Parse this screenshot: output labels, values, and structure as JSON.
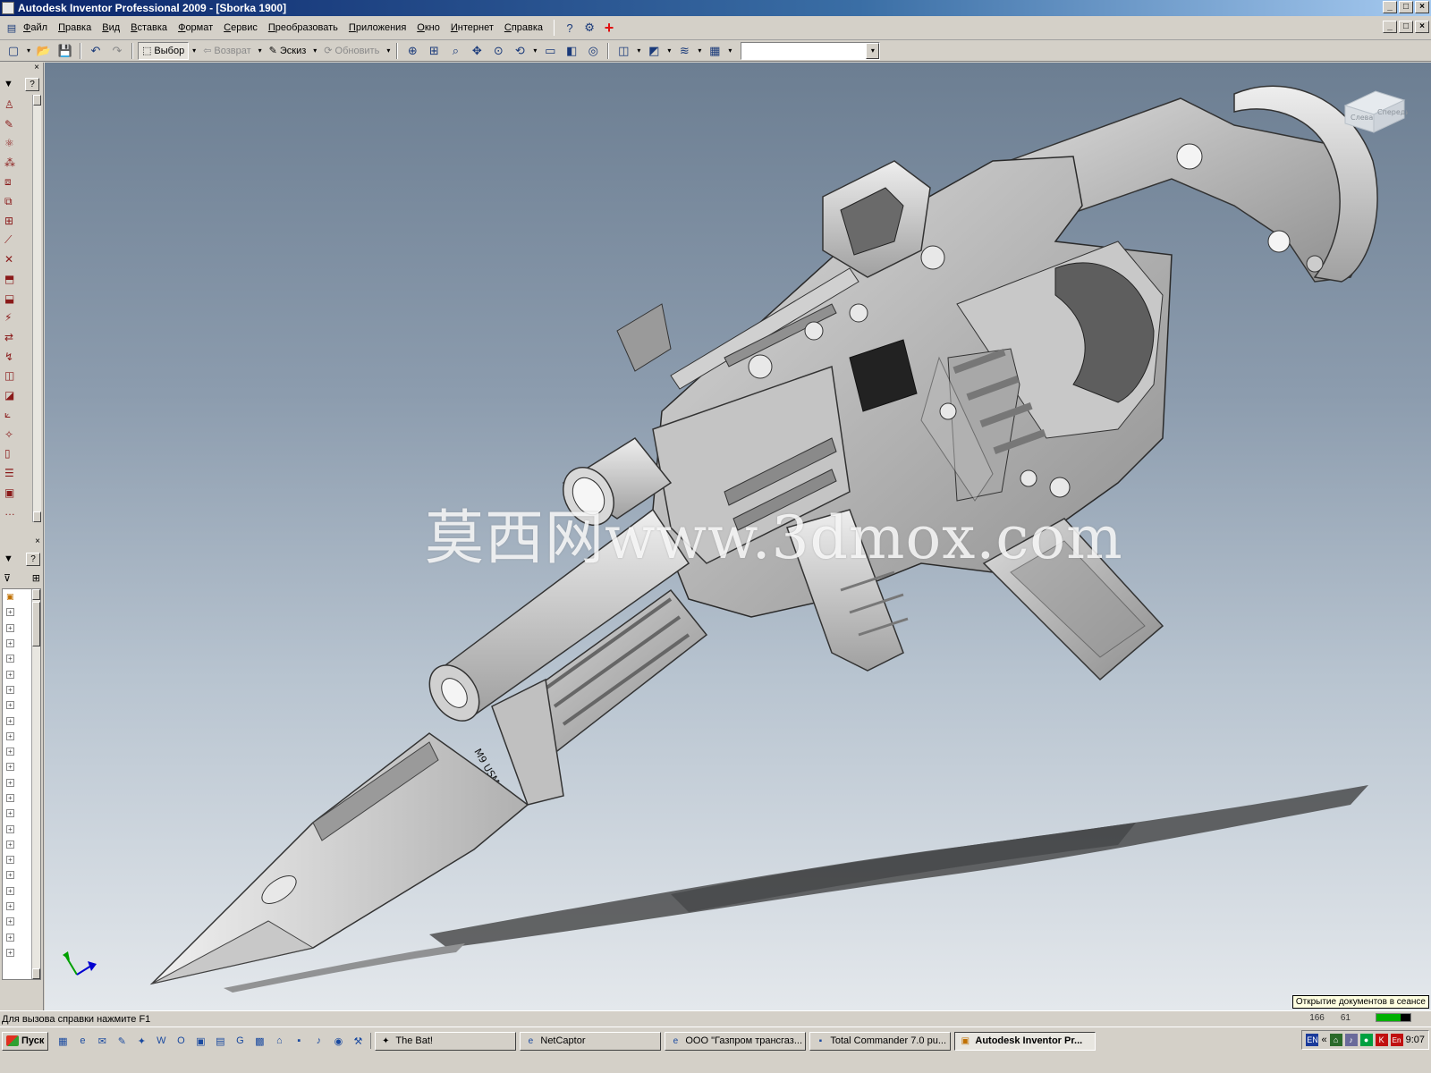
{
  "window": {
    "title": "Autodesk Inventor Professional 2009 - [Sborka 1900]",
    "controls": [
      "_",
      "□",
      "×"
    ]
  },
  "menu": {
    "items": [
      "Файл",
      "Правка",
      "Вид",
      "Вставка",
      "Формат",
      "Сервис",
      "Преобразовать",
      "Приложения",
      "Окно",
      "Интернет",
      "Справка"
    ]
  },
  "toolbar": {
    "select_label": "Выбор",
    "return_label": "Возврат",
    "sketch_label": "Эскиз",
    "update_label": "Обновить",
    "combo_value": ""
  },
  "viewport": {
    "watermark": "莫西网www.3dmox.com",
    "viewcube_faces": [
      "Слева",
      "Спереди"
    ],
    "model_markings": [
      "M9 USMC"
    ]
  },
  "statusbar": {
    "help_text": "Для вызова справки нажмите F1",
    "tooltip": "Открытие документов в сеансе",
    "count_a": "166",
    "count_b": "61"
  },
  "taskbar": {
    "start_label": "Пуск",
    "tasks": [
      {
        "label": "The Bat!",
        "icon": "bat-icon",
        "active": false
      },
      {
        "label": "NetCaptor",
        "icon": "netcaptor-icon",
        "active": false
      },
      {
        "label": "ООО \"Газпром трансгаз...",
        "icon": "ie-icon",
        "active": false
      },
      {
        "label": "Total Commander 7.0 pu...",
        "icon": "disk-icon",
        "active": false
      },
      {
        "label": "Autodesk Inventor Pr...",
        "icon": "inventor-icon",
        "active": true
      }
    ],
    "tray": {
      "lang": "EN",
      "lang2": "En",
      "clock": "9:07"
    }
  },
  "colors": {
    "titlebar_start": "#0a246a",
    "titlebar_end": "#a6caf0",
    "chrome": "#d4d0c8",
    "viewport_top": "#6c7e92",
    "viewport_bottom": "#e4e8ec"
  }
}
